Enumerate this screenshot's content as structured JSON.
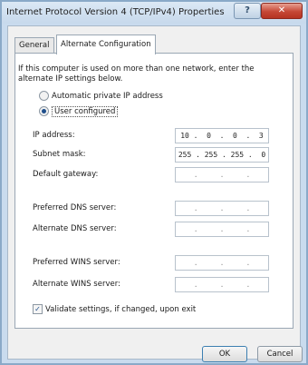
{
  "window": {
    "title": "Internet Protocol Version 4 (TCP/IPv4) Properties",
    "help_label": "?",
    "close_label": "✕"
  },
  "tabs": [
    {
      "label": "General"
    },
    {
      "label": "Alternate Configuration"
    }
  ],
  "intro_text": "If this computer is used on more than one network, enter the alternate IP settings below.",
  "options": {
    "automatic_label": "Automatic private IP address",
    "user_label": "User configured",
    "selected": "User configured"
  },
  "fields": [
    {
      "label": "IP address:",
      "value": "10 .  0  .  0  .  3"
    },
    {
      "label": "Subnet mask:",
      "value": "255 . 255 . 255 .  0"
    },
    {
      "label": "Default gateway:",
      "value": " .     .     . "
    },
    {
      "label": "Preferred DNS server:",
      "value": " .     .     . "
    },
    {
      "label": "Alternate DNS server:",
      "value": " .     .     . "
    },
    {
      "label": "Preferred WINS server:",
      "value": " .     .     . "
    },
    {
      "label": "Alternate WINS server:",
      "value": " .     .     . "
    }
  ],
  "validate": {
    "label": "Validate settings, if changed, upon exit",
    "checked": true,
    "mark": "✓"
  },
  "buttons": {
    "ok": "OK",
    "cancel": "Cancel"
  }
}
